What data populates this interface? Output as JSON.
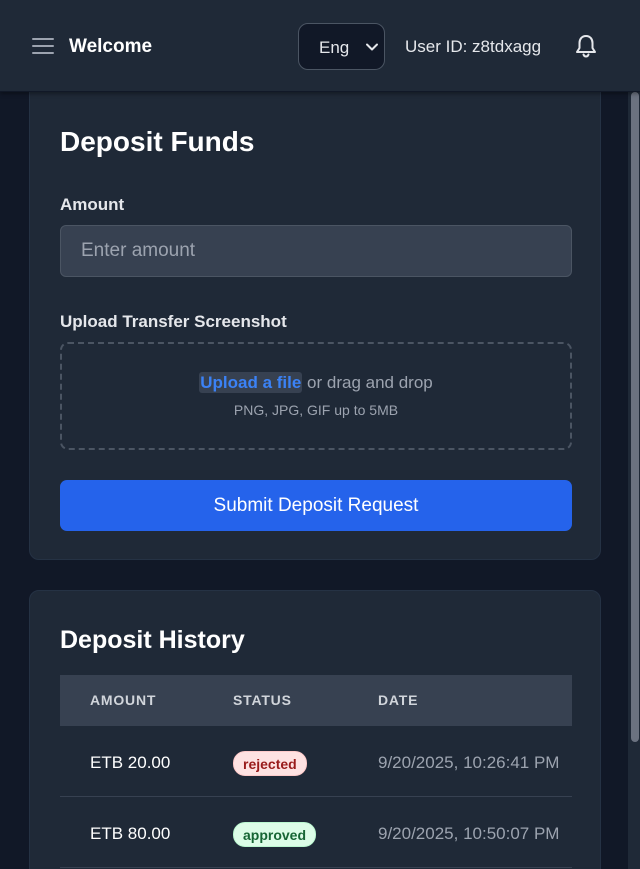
{
  "header": {
    "title": "Welcome",
    "language": "Eng",
    "user_id": "User ID: z8tdxagg"
  },
  "deposit": {
    "title": "Deposit Funds",
    "amount_label": "Amount",
    "amount_placeholder": "Enter amount",
    "upload_label": "Upload Transfer Screenshot",
    "upload_link": "Upload a file",
    "drag_text": "or drag and drop",
    "file_hint": "PNG, JPG, GIF up to 5MB",
    "submit_label": "Submit Deposit Request"
  },
  "history": {
    "title": "Deposit History",
    "columns": [
      "AMOUNT",
      "STATUS",
      "DATE"
    ],
    "rows": [
      {
        "amount": "ETB 20.00",
        "status": "rejected",
        "date": "9/20/2025, 10:26:41 PM"
      },
      {
        "amount": "ETB 80.00",
        "status": "approved",
        "date": "9/20/2025, 10:50:07 PM"
      }
    ]
  },
  "icons": {
    "menu": "hamburger-menu-icon",
    "language_chevron": "chevron-down-icon",
    "notifications": "bell-icon"
  },
  "colors": {
    "background": "#111827",
    "surface": "#1f2937",
    "accent": "#2563eb",
    "link": "#3b82f6",
    "rejected_bg": "#fee2e2",
    "rejected_text": "#991b1b",
    "approved_bg": "#dcfce7",
    "approved_text": "#166534"
  }
}
